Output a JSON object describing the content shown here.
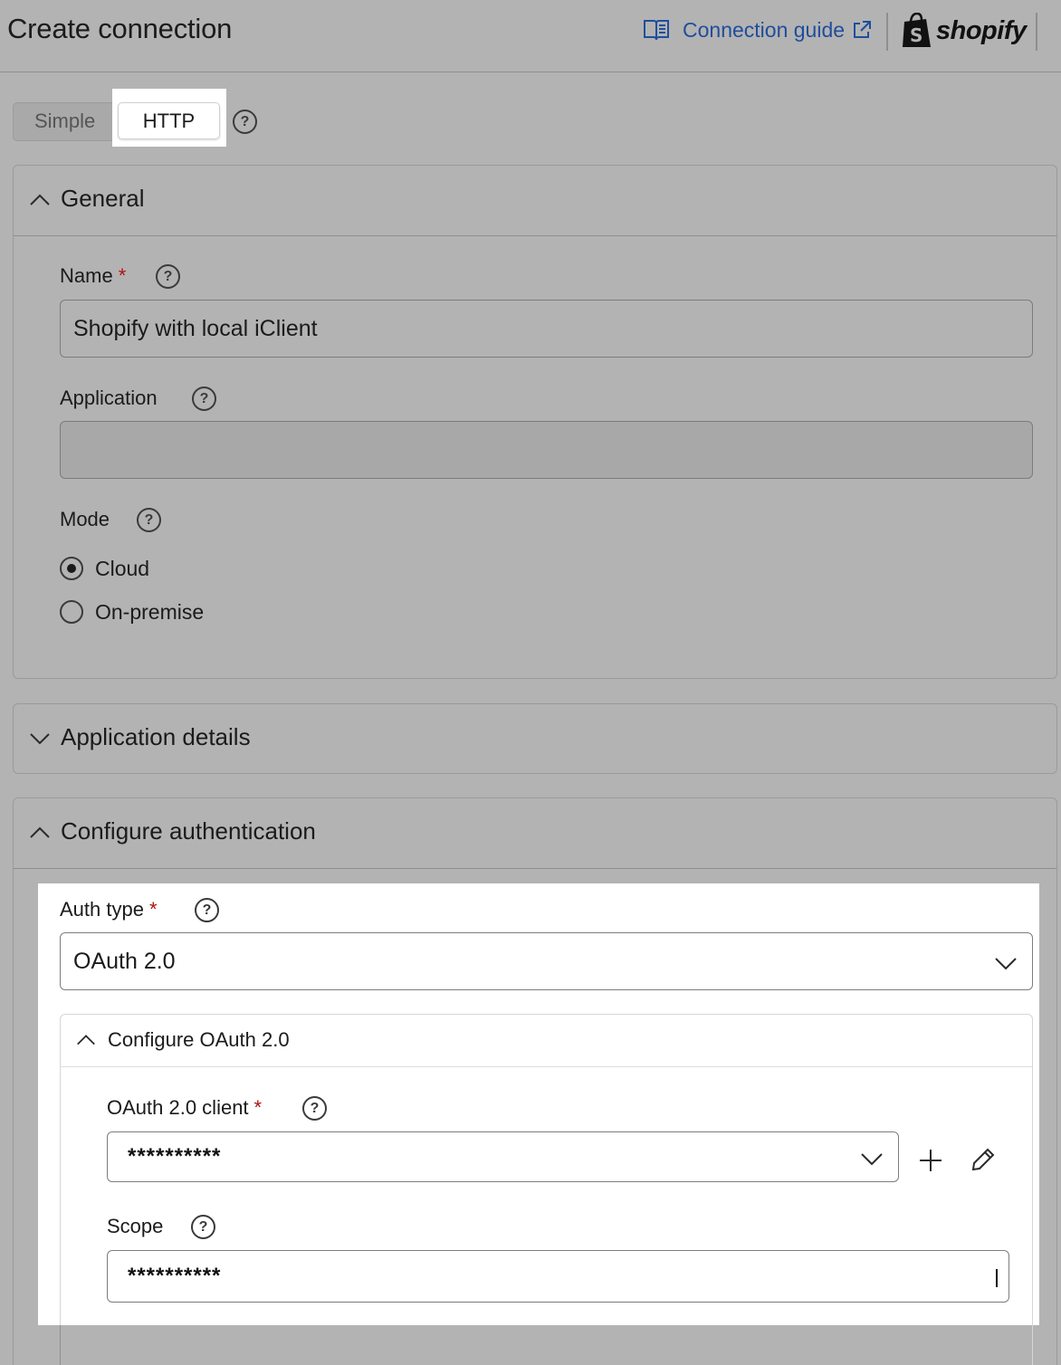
{
  "header": {
    "title": "Create connection",
    "guide_label": "Connection guide",
    "brand": "shopify"
  },
  "mode_toggle": {
    "options": [
      "Simple",
      "HTTP"
    ],
    "selected": "HTTP"
  },
  "general": {
    "title": "General",
    "name_label": "Name",
    "name_value": "Shopify with local iClient",
    "application_label": "Application",
    "application_value": "",
    "mode_label": "Mode",
    "mode_options": [
      "Cloud",
      "On-premise"
    ],
    "mode_selected": "Cloud"
  },
  "application_details": {
    "title": "Application details"
  },
  "auth": {
    "title": "Configure authentication",
    "auth_type_label": "Auth type",
    "auth_type_value": "OAuth 2.0",
    "oauth_title": "Configure OAuth 2.0",
    "client_label": "OAuth 2.0 client",
    "client_value": "**********",
    "scope_label": "Scope",
    "scope_value": "**********"
  },
  "colors": {
    "link": "#1f4e9c",
    "required": "#b01010",
    "overlay": "#b3b3b3"
  }
}
